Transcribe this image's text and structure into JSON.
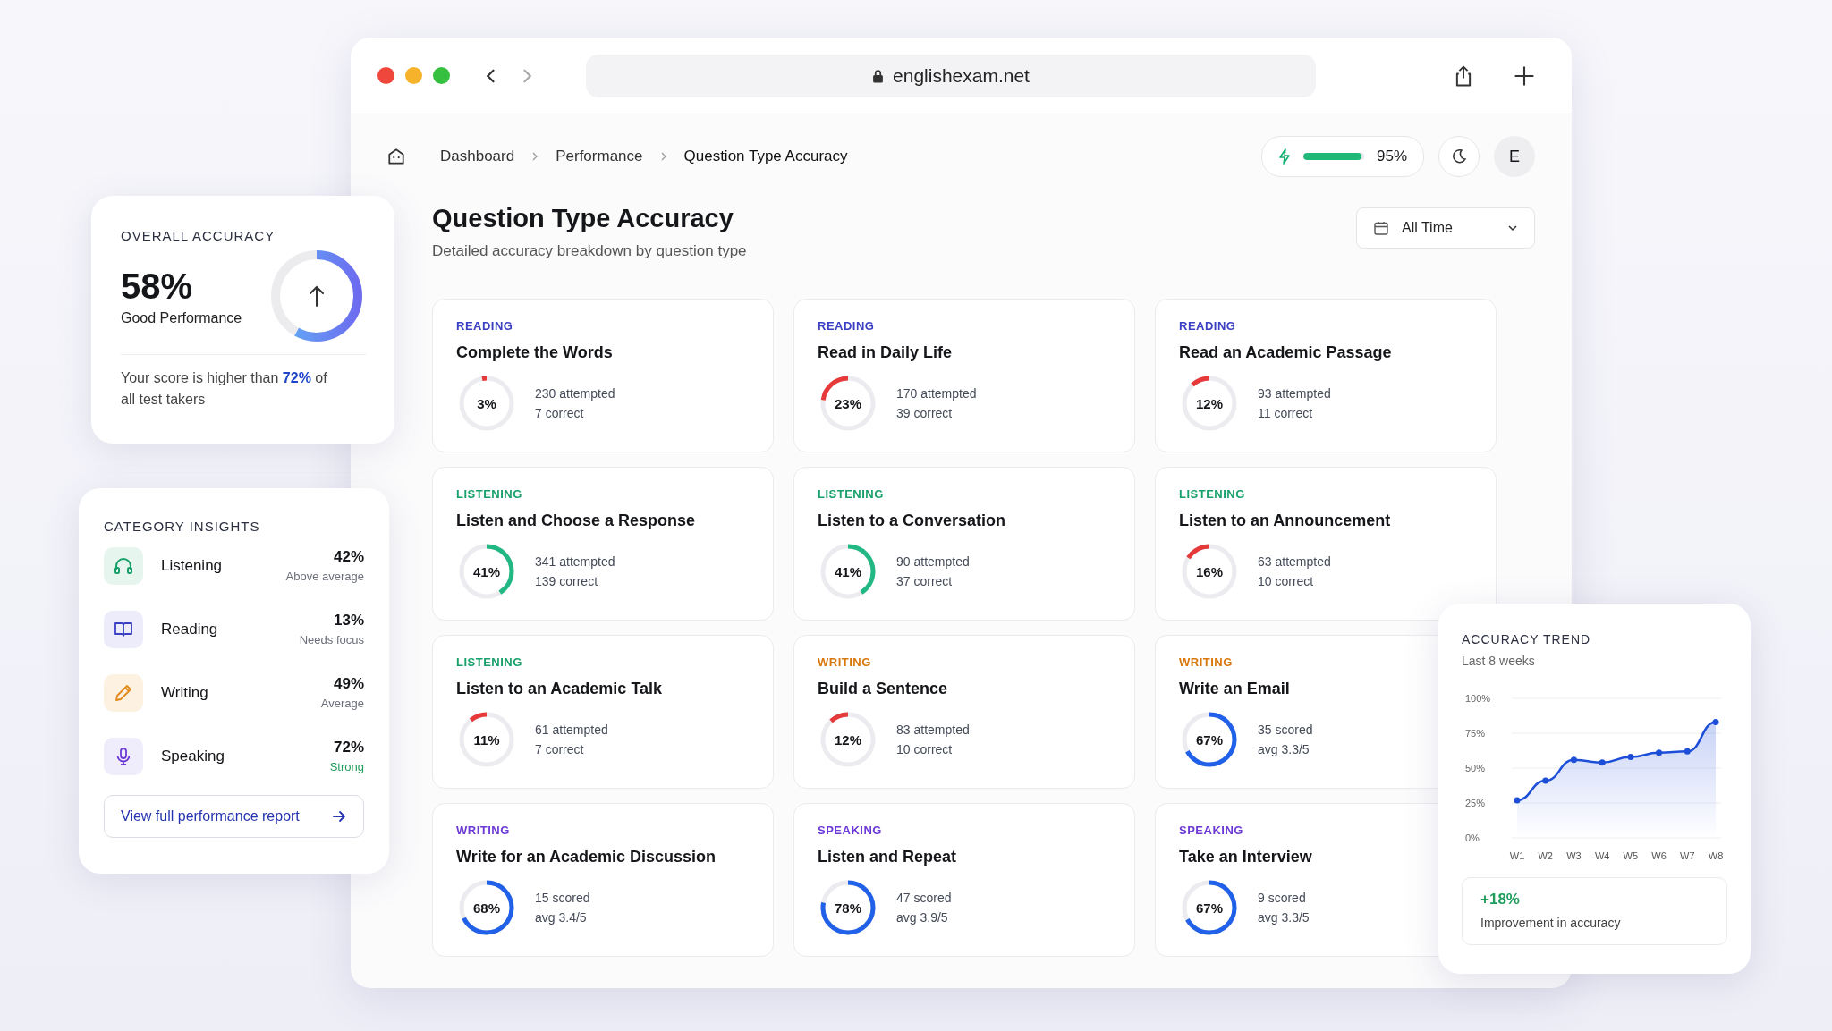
{
  "browser": {
    "url": "englishexam.net"
  },
  "breadcrumb": [
    "Dashboard",
    "Performance",
    "Question Type Accuracy"
  ],
  "streak": {
    "level": 0.95,
    "reading": "95%"
  },
  "avatar": "E",
  "page": {
    "title": "Question Type Accuracy",
    "subtitle": "Detailed accuracy breakdown by question type",
    "filter": "All Time"
  },
  "cards": [
    {
      "category": "READING",
      "color": "#3b3fc4",
      "title": "Complete the Words",
      "percent": "3%",
      "level": 0.03,
      "line1": "230 attempted",
      "line2": "7 correct"
    },
    {
      "category": "READING",
      "color": "#3b3fc4",
      "title": "Read in Daily Life",
      "percent": "23%",
      "level": 0.23,
      "line1": "170 attempted",
      "line2": "39 correct"
    },
    {
      "category": "READING",
      "color": "#3b3fc4",
      "title": "Read an Academic Passage",
      "percent": "12%",
      "level": 0.12,
      "line1": "93 attempted",
      "line2": "11 correct"
    },
    {
      "category": "LISTENING",
      "color": "#17a06a",
      "title": "Listen and Choose a Response",
      "percent": "41%",
      "level": 0.41,
      "line1": "341 attempted",
      "line2": "139 correct"
    },
    {
      "category": "LISTENING",
      "color": "#17a06a",
      "title": "Listen to a Conversation",
      "percent": "41%",
      "level": 0.41,
      "line1": "90 attempted",
      "line2": "37 correct"
    },
    {
      "category": "LISTENING",
      "color": "#17a06a",
      "title": "Listen to an Announcement",
      "percent": "16%",
      "level": 0.16,
      "line1": "63 attempted",
      "line2": "10 correct"
    },
    {
      "category": "LISTENING",
      "color": "#17a06a",
      "title": "Listen to an Academic Talk",
      "percent": "11%",
      "level": 0.11,
      "line1": "61 attempted",
      "line2": "7 correct"
    },
    {
      "category": "WRITING",
      "color": "#d9770b",
      "title": "Build a Sentence",
      "percent": "12%",
      "level": 0.12,
      "line1": "83 attempted",
      "line2": "10 correct"
    },
    {
      "category": "WRITING",
      "color": "#d9770b",
      "title": "Write an Email",
      "percent": "67%",
      "level": 0.67,
      "line1": "35 scored",
      "line2": "avg 3.3/5"
    },
    {
      "category": "WRITING",
      "color": "#6d3ad6",
      "title": "Write for an Academic Discussion",
      "percent": "68%",
      "level": 0.68,
      "line1": "15 scored",
      "line2": "avg 3.4/5"
    },
    {
      "category": "SPEAKING",
      "color": "#6d3ad6",
      "title": "Listen and Repeat",
      "percent": "78%",
      "level": 0.78,
      "line1": "47 scored",
      "line2": "avg 3.9/5"
    },
    {
      "category": "SPEAKING",
      "color": "#6d3ad6",
      "title": "Take an Interview",
      "percent": "67%",
      "level": 0.67,
      "line1": "9 scored",
      "line2": "avg 3.3/5"
    }
  ],
  "overall": {
    "heading": "OVERALL ACCURACY",
    "value": "58%",
    "label": "Good Performance",
    "level": 0.58,
    "note": "Your score is higher than **72%** of all test takers"
  },
  "insights": {
    "heading": "CATEGORY INSIGHTS",
    "items": [
      {
        "name": "Listening",
        "value": "42%",
        "status": "Above average",
        "color": "#6b6f7b"
      },
      {
        "name": "Reading",
        "value": "13%",
        "status": "Needs focus",
        "color": "#6b6f7b"
      },
      {
        "name": "Writing",
        "value": "49%",
        "status": "Average",
        "color": "#6b6f7b"
      },
      {
        "name": "Speaking",
        "value": "72%",
        "status": "Strong",
        "color": "#1f9d5c"
      }
    ],
    "link": "View full performance report"
  },
  "trend": {
    "heading": "ACCURACY TREND",
    "subtitle": "Last 8 weeks",
    "chart_data": {
      "type": "area",
      "categories": [
        "W1",
        "W2",
        "W3",
        "W4",
        "W5",
        "W6",
        "W7",
        "W8"
      ],
      "series": [
        {
          "color": "#1d4ed8",
          "values": [
            27,
            41,
            56,
            54,
            58,
            61,
            62,
            83
          ]
        }
      ],
      "grid": true,
      "ylim": [
        0,
        100
      ],
      "yticks": [
        {
          "value": 100,
          "label": "100%"
        },
        {
          "value": 75,
          "label": "75%"
        },
        {
          "value": 50,
          "label": "50%"
        },
        {
          "value": 25,
          "label": "25%"
        },
        {
          "value": 0,
          "label": "0%"
        }
      ]
    },
    "change": "+18%",
    "change_label": "Improvement in accuracy"
  }
}
